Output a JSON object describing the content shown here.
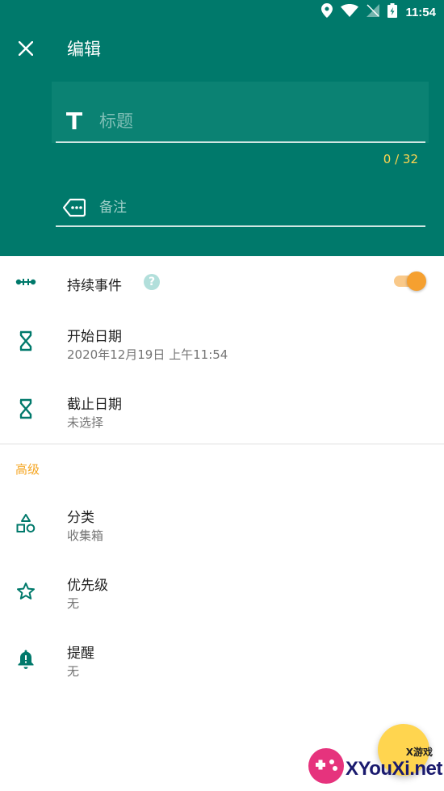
{
  "status_bar": {
    "time": "11:54",
    "icons": [
      "location-icon",
      "wifi-icon",
      "no-signal-icon",
      "battery-charging-icon"
    ]
  },
  "header": {
    "title": "编辑",
    "title_placeholder": "标题",
    "title_value": "",
    "char_counter": "0 / 32",
    "note_placeholder": "备注",
    "note_value": ""
  },
  "settings": {
    "continuous": {
      "label": "持续事件",
      "help": "?",
      "toggle_on": true
    },
    "start_date": {
      "label": "开始日期",
      "value": "2020年12月19日 上午11:54"
    },
    "end_date": {
      "label": "截止日期",
      "value": "未选择"
    }
  },
  "advanced": {
    "section_title": "高级",
    "category": {
      "label": "分类",
      "value": "收集箱"
    },
    "priority": {
      "label": "优先级",
      "value": "无"
    },
    "reminder": {
      "label": "提醒",
      "value": "无"
    }
  },
  "watermark": {
    "small": "X游戏",
    "big": "XYouXi.net"
  },
  "colors": {
    "primary": "#00796b",
    "accent": "#f5a623",
    "fab": "#ffd54f",
    "icon_teal": "#00796b"
  }
}
